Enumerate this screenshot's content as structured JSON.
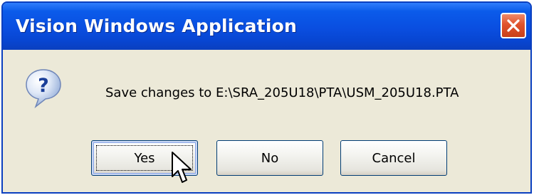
{
  "window": {
    "title": "Vision Windows Application"
  },
  "dialog": {
    "icon": "question-icon",
    "message": "Save changes to E:\\SRA_205U18\\PTA\\USM_205U18.PTA"
  },
  "buttons": {
    "yes": "Yes",
    "no": "No",
    "cancel": "Cancel"
  },
  "colors": {
    "titlebar": "#0a4ee0",
    "close_button": "#e0522c",
    "dialog_background": "#ece9d8"
  }
}
